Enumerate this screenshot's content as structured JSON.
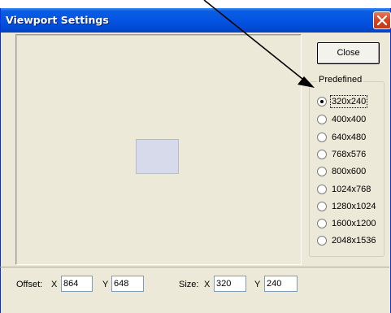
{
  "window": {
    "title": "Viewport Settings"
  },
  "buttons": {
    "close_label": "Close"
  },
  "predefined": {
    "legend": "Predefined",
    "selected": "320x240",
    "options": [
      "320x240",
      "400x400",
      "640x480",
      "768x576",
      "800x600",
      "1024x768",
      "1280x1024",
      "1600x1200",
      "2048x1536"
    ]
  },
  "offset": {
    "label": "Offset:",
    "x_label": "X",
    "x_value": "864",
    "y_label": "Y",
    "y_value": "648"
  },
  "size": {
    "label": "Size:",
    "x_label": "X",
    "x_value": "320",
    "y_label": "Y",
    "y_value": "240"
  },
  "colors": {
    "titlebar": "#0454e3",
    "dialog_bg": "#ece9d8",
    "viewport_rect": "#d6daeb",
    "close_x": "#d4451f"
  },
  "icons": {
    "title_close": "close-icon",
    "pointer": "arrow-pointer-icon"
  }
}
